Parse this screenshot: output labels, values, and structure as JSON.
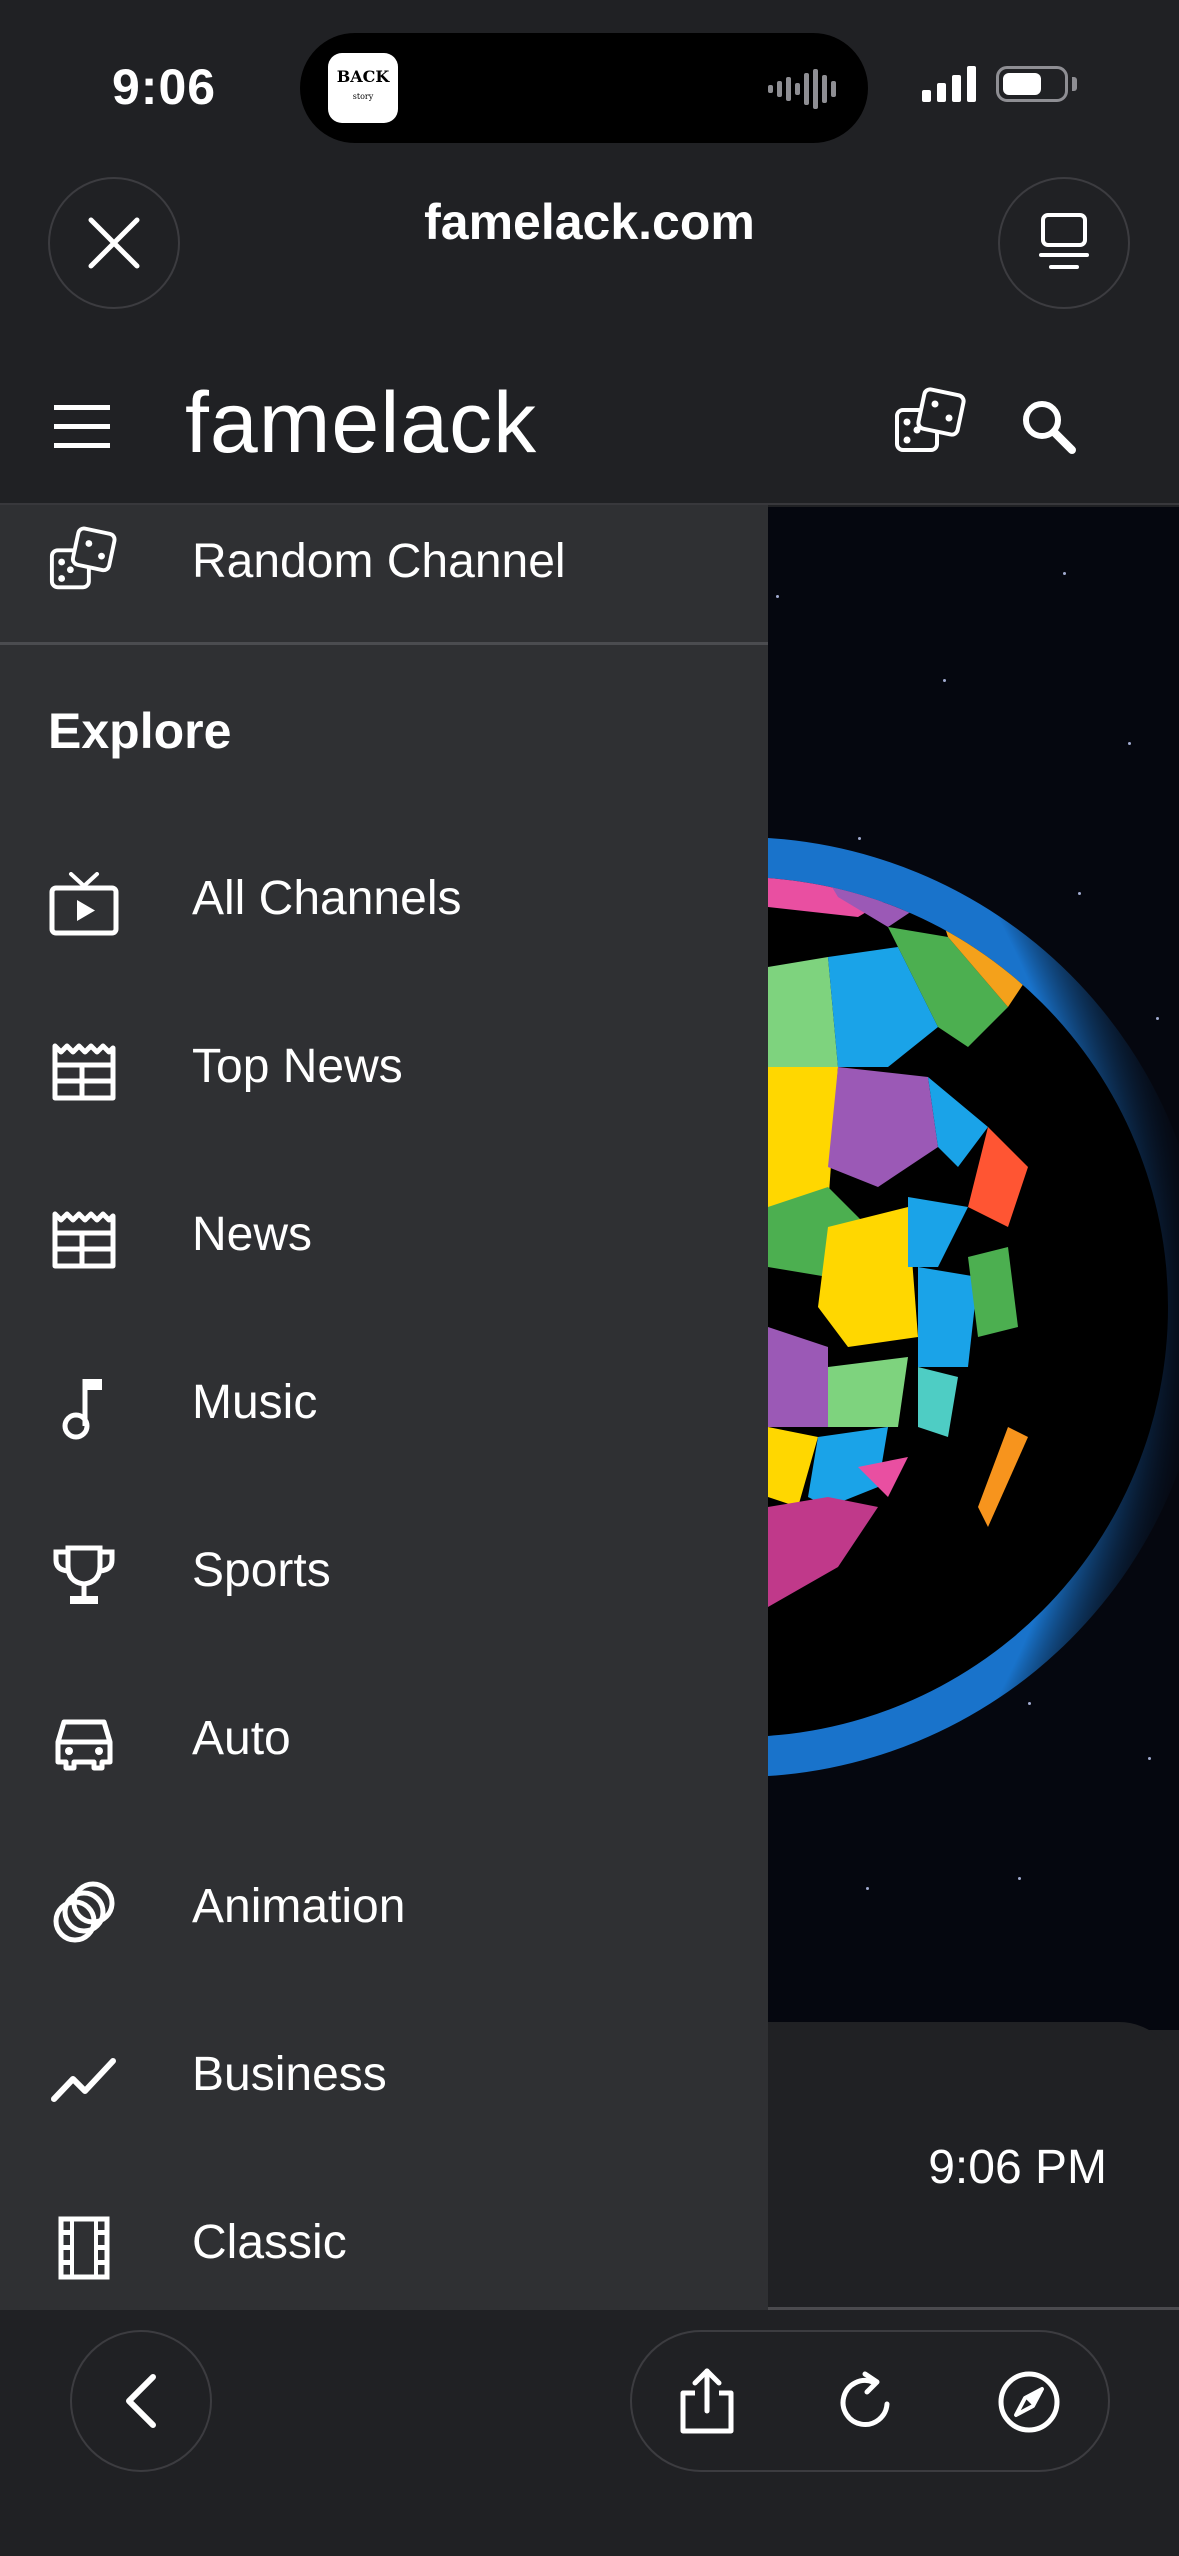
{
  "status_bar": {
    "time": "9:06",
    "island_app": {
      "name": "BACK",
      "sub": "story"
    }
  },
  "browser": {
    "url": "famelack.com",
    "close_icon": "close-icon",
    "tabs_icon": "tab-overview-icon"
  },
  "site": {
    "logo": "famelack",
    "random_icon": "dice-icon",
    "search_icon": "search-icon"
  },
  "drawer": {
    "random_channel": {
      "label": "Random Channel",
      "icon": "dice-icon"
    },
    "section_title": "Explore",
    "items": [
      {
        "label": "All Channels",
        "icon": "tv-icon"
      },
      {
        "label": "Top News",
        "icon": "newspaper-icon"
      },
      {
        "label": "News",
        "icon": "newspaper-icon"
      },
      {
        "label": "Music",
        "icon": "music-note-icon"
      },
      {
        "label": "Sports",
        "icon": "trophy-icon"
      },
      {
        "label": "Auto",
        "icon": "car-icon"
      },
      {
        "label": "Animation",
        "icon": "animation-icon"
      },
      {
        "label": "Business",
        "icon": "trending-icon"
      },
      {
        "label": "Classic",
        "icon": "film-icon"
      }
    ]
  },
  "player": {
    "time": "9:06 PM"
  },
  "toolbar": {
    "back_icon": "chevron-left-icon",
    "share_icon": "share-icon",
    "reload_icon": "reload-icon",
    "compass_icon": "compass-icon"
  }
}
